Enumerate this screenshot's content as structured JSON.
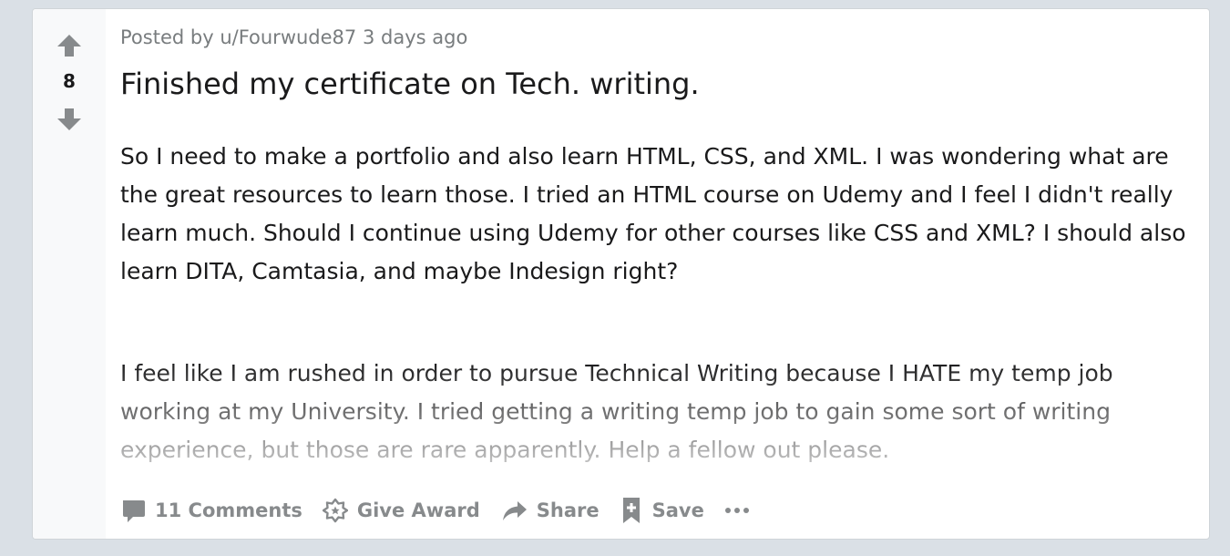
{
  "post": {
    "score": "8",
    "posted_by": "Posted by",
    "username": "u/Fourwude87",
    "time": "3 days ago",
    "title": "Finished my certificate on Tech. writing.",
    "body_paragraphs": [
      "So I need to make a portfolio and also learn HTML, CSS, and XML. I was wondering what are the great resources to learn those. I tried an HTML course on Udemy and I feel I didn't really learn much. Should I continue using Udemy for other courses like CSS and XML? I should also learn DITA, Camtasia, and maybe Indesign right?",
      "I feel like I am rushed in order to pursue Technical Writing because I HATE my temp job working at my University. I tried getting a writing temp job to gain some sort of writing experience, but those are rare apparently. Help a fellow out please."
    ]
  },
  "actions": {
    "comments_label": "11 Comments",
    "award_label": "Give Award",
    "share_label": "Share",
    "save_label": "Save"
  },
  "icons": {
    "upvote": "arrow-up-icon",
    "downvote": "arrow-down-icon",
    "comments": "comment-bubble-icon",
    "award": "award-icon",
    "share": "share-arrow-icon",
    "save": "bookmark-icon",
    "more": "more-dots-icon"
  },
  "colors": {
    "background": "#dae0e6",
    "card": "#ffffff",
    "vote_column": "#f8f9fa",
    "text": "#1a1a1b",
    "muted": "#878a8c"
  }
}
